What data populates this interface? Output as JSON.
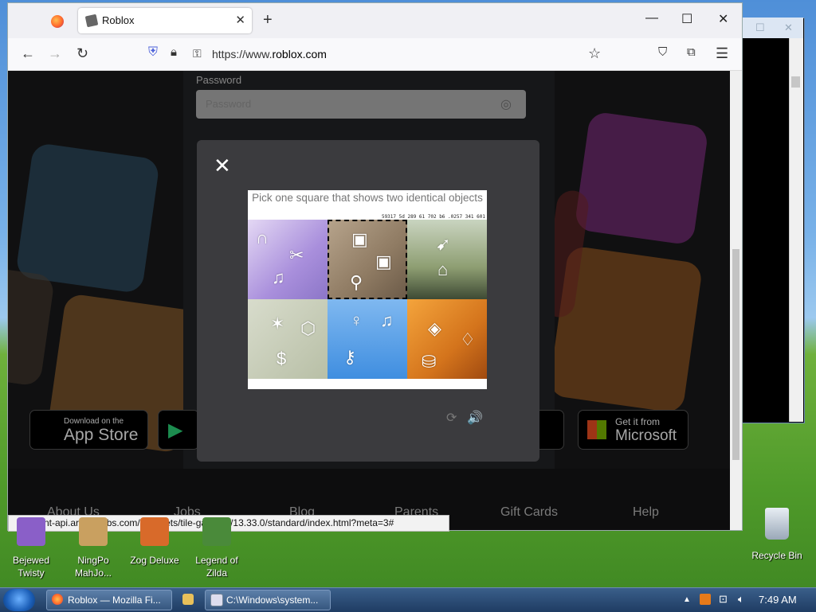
{
  "browser": {
    "tab_title": "Roblox",
    "tab_close": "✕",
    "new_tab": "+",
    "minimize": "—",
    "maximize": "☐",
    "close": "✕",
    "url_prefix": "https://www.",
    "url_domain": "roblox.com"
  },
  "page": {
    "password_label": "Password",
    "password_placeholder": "Password",
    "app_store_small": "Download on the",
    "app_store_big": "App Store",
    "microsoft_small": "Get it from",
    "microsoft_big": "Microsoft",
    "footer_links": [
      "About Us",
      "Jobs",
      "Blog",
      "Parents",
      "Gift Cards",
      "Help"
    ]
  },
  "captcha": {
    "close": "✕",
    "question": "Pick one square that shows two identical objects",
    "challenge_id": "59317 5d 289 61 702 b6 .0257 341 601",
    "reload": "⟳",
    "audio": "🔊"
  },
  "status_url": "client-api.arkoselabs.com/fc/assets/tile-game-ui/13.33.0/standard/index.html?meta=3#",
  "desktop_icons": [
    {
      "label": "Bejewed Twisty"
    },
    {
      "label": "NingPo MahJo..."
    },
    {
      "label": "Zog Deluxe"
    },
    {
      "label": "Legend of Zilda"
    },
    {
      "label": "Recycle Bin"
    }
  ],
  "taskbar": {
    "items": [
      "Roblox — Mozilla Fi...",
      "C:\\Windows\\system..."
    ],
    "clock": "7:49 AM"
  },
  "colors": {
    "modal_bg": "#3b3b3e",
    "page_bg": "#1a1a1b",
    "taskbar": "#1f3c63"
  }
}
